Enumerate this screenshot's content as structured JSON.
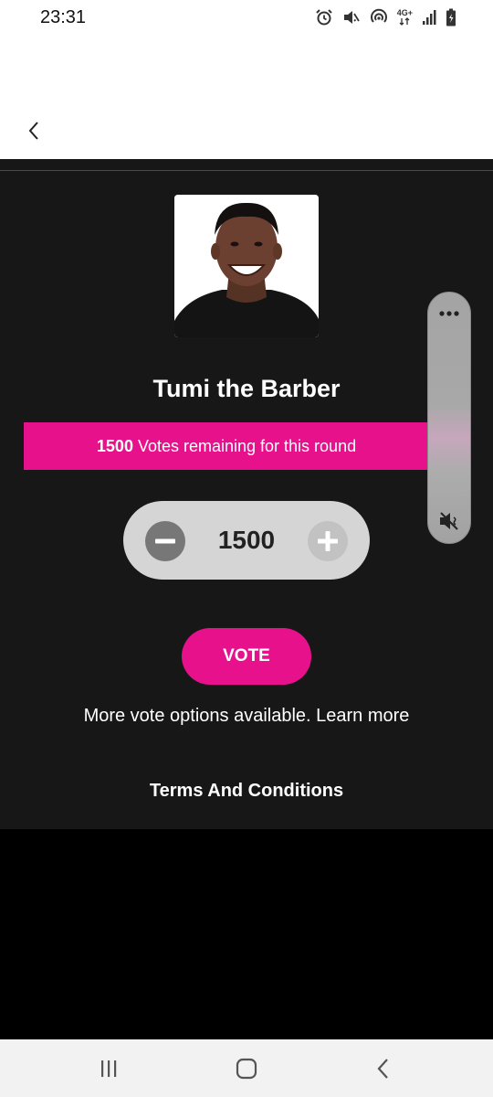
{
  "status_bar": {
    "time": "23:31",
    "network_label": "4G+",
    "icons": [
      "alarm-icon",
      "mute-icon",
      "hotspot-icon",
      "network-4g-icon",
      "signal-icon",
      "battery-charging-icon"
    ]
  },
  "header": {
    "back_icon": "chevron-left-icon"
  },
  "contestant": {
    "name": "Tumi the Barber",
    "photo": "contestant-photo"
  },
  "votes_banner": {
    "count": "1500",
    "text": "Votes remaining for this round"
  },
  "stepper": {
    "value": "1500",
    "minus_icon": "minus-icon",
    "plus_icon": "plus-icon"
  },
  "vote_button": {
    "label": "VOTE"
  },
  "more_options": {
    "text": "More vote options available. Learn more"
  },
  "terms": {
    "label": "Terms And Conditions"
  },
  "volume_panel": {
    "menu_icon": "more-dots-icon",
    "mute_icon": "volume-mute-icon"
  },
  "nav_bar": {
    "icons": [
      "recents-icon",
      "home-icon",
      "back-icon"
    ]
  },
  "colors": {
    "accent": "#e8118c",
    "content_background": "#181718",
    "header_background": "#ffffff",
    "stepper_background": "#d5d5d5"
  }
}
